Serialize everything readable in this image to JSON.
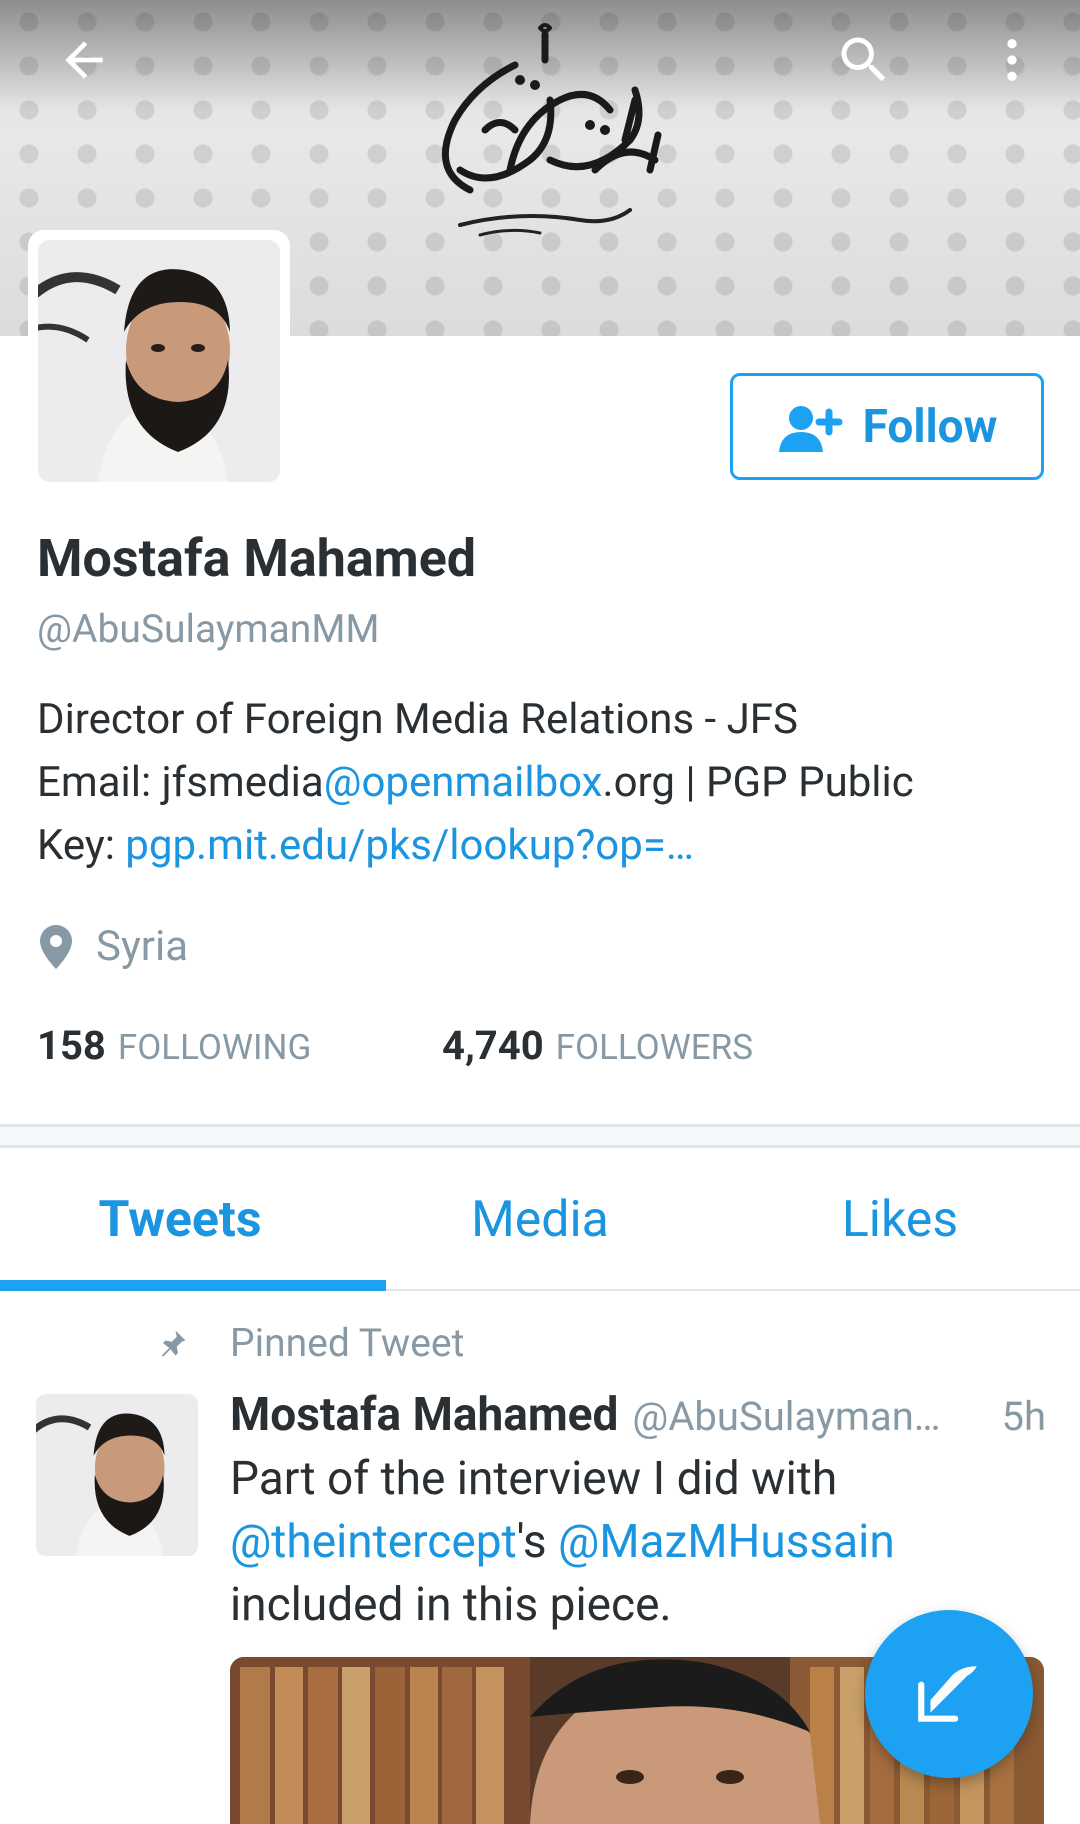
{
  "header": {
    "back_icon": "arrow-back-icon",
    "search_icon": "search-icon",
    "more_icon": "more-vert-icon",
    "banner_emblem": "calligraphy-logo"
  },
  "profile": {
    "follow_label": "Follow",
    "name": "Mostafa Mahamed",
    "handle": "@AbuSulaymanMM",
    "bio_line1": "Director of Foreign Media Relations - JFS",
    "bio_email_prefix": "Email: jfsmedia",
    "bio_email_link": "@openmailbox",
    "bio_email_suffix": ".org | PGP Public",
    "bio_key_label": "Key: ",
    "bio_key_link": "pgp.mit.edu/pks/lookup?op=…",
    "location": "Syria"
  },
  "stats": {
    "following_count": "158",
    "following_label": "FOLLOWING",
    "followers_count": "4,740",
    "followers_label": "FOLLOWERS"
  },
  "tabs": [
    {
      "label": "Tweets",
      "active": true
    },
    {
      "label": "Media",
      "active": false
    },
    {
      "label": "Likes",
      "active": false
    }
  ],
  "pinned_tweet": {
    "pinned_label": "Pinned Tweet",
    "name": "Mostafa Mahamed",
    "handle": "@AbuSulayman…",
    "time": "5h",
    "text_part1": "Part of the interview I did with",
    "mention1": "@theintercept",
    "text_part2": "'s ",
    "mention2": "@MazMHussain",
    "text_part3": "included in this piece."
  },
  "colors": {
    "accent": "#1da1f2",
    "link": "#1b95e0",
    "secondary_text": "#8899a6",
    "primary_text": "#292f33"
  }
}
